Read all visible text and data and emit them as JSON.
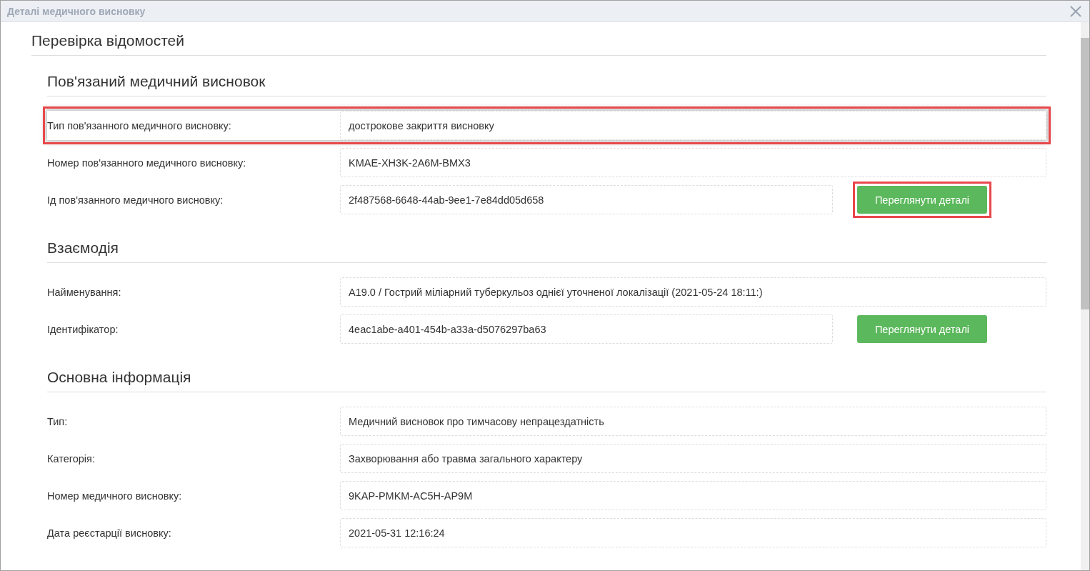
{
  "window": {
    "title": "Деталі медичного висновку"
  },
  "page_title": "Перевірка відомостей",
  "sections": [
    {
      "title": "Пов'язаний медичний висновок",
      "rows": [
        {
          "label": "Тип пов'язанного медичного висновку:",
          "value": "дострокове закриття висновку",
          "highlighted": true
        },
        {
          "label": "Номер пов'язанного медичного висновку:",
          "value": "KMAE-XH3K-2A6M-BMX3",
          "highlighted": false
        },
        {
          "label": "Ід пов'язанного медичного висновку:",
          "value": "2f487568-6648-44ab-9ee1-7e84dd05d658",
          "highlighted": false,
          "button": {
            "label": "Переглянути деталі",
            "highlighted": true
          }
        }
      ]
    },
    {
      "title": "Взаємодія",
      "rows": [
        {
          "label": "Найменування:",
          "value": "A19.0 / Гострий міліарний туберкульоз однієї уточненої локалізації (2021-05-24 18:11:)",
          "highlighted": false
        },
        {
          "label": "Ідентифікатор:",
          "value": "4eac1abe-a401-454b-a33a-d5076297ba63",
          "highlighted": false,
          "button": {
            "label": "Переглянути деталі",
            "highlighted": false
          }
        }
      ]
    },
    {
      "title": "Основна інформація",
      "rows": [
        {
          "label": "Тип:",
          "value": "Медичний висновок про тимчасову непрацездатність",
          "highlighted": false
        },
        {
          "label": "Категорія:",
          "value": "Захворювання або травма загального характеру",
          "highlighted": false
        },
        {
          "label": "Номер медичного висновку:",
          "value": "9KAP-PMKM-AC5H-AP9M",
          "highlighted": false
        },
        {
          "label": "Дата реєстарції висновку:",
          "value": "2021-05-31 12:16:24",
          "highlighted": false
        }
      ]
    }
  ]
}
